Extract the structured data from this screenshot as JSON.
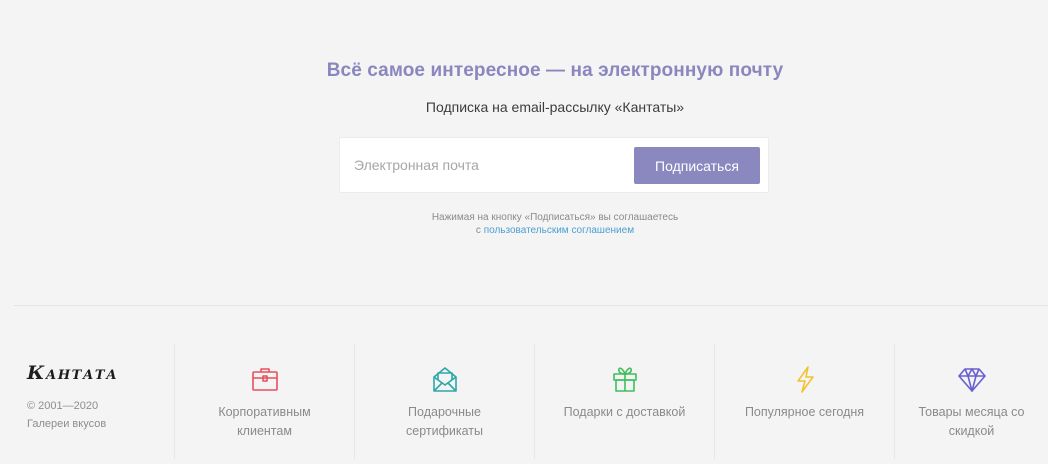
{
  "subscribe": {
    "title": "Всё самое интересное — на электронную почту",
    "subtitle": "Подписка на email-рассылку «Кантаты»",
    "email_placeholder": "Электронная почта",
    "button_label": "Подписаться",
    "note_line1": "Нажимая на кнопку «Подписаться» вы соглашаетесь",
    "note_prefix": "с",
    "note_link": "пользовательским соглашением"
  },
  "footer": {
    "logo": "Кантата",
    "copyright": "© 2001—2020",
    "tagline": "Галереи вкусов",
    "links": [
      {
        "label": "Корпоративным клиентам",
        "icon": "briefcase-icon",
        "color": "#e8505b"
      },
      {
        "label": "Подарочные сертификаты",
        "icon": "envelope-certificate-icon",
        "color": "#2ba8a8"
      },
      {
        "label": "Подарки с доставкой",
        "icon": "gift-icon",
        "color": "#3fbf5a"
      },
      {
        "label": "Популярное сегодня",
        "icon": "lightning-icon",
        "color": "#f2c230"
      },
      {
        "label": "Товары месяца со скидкой",
        "icon": "diamond-icon",
        "color": "#6a5fcf"
      }
    ]
  },
  "colors": {
    "accent": "#8b87bf",
    "link": "#4a9fd3",
    "background": "#f4f4f4"
  }
}
